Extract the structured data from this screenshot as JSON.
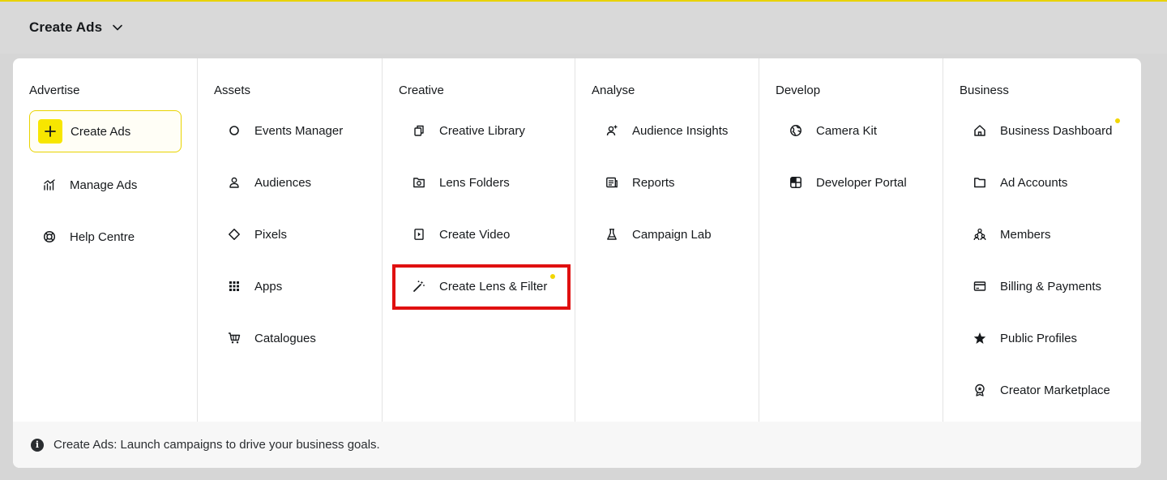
{
  "header": {
    "title": "Create Ads"
  },
  "columns": [
    {
      "heading": "Advertise",
      "items": [
        {
          "label": "Create Ads",
          "icon": "plus-icon"
        },
        {
          "label": "Manage Ads",
          "icon": "chart-icon"
        },
        {
          "label": "Help Centre",
          "icon": "lifebuoy-icon"
        }
      ]
    },
    {
      "heading": "Assets",
      "items": [
        {
          "label": "Events Manager",
          "icon": "circle-icon"
        },
        {
          "label": "Audiences",
          "icon": "person-icon"
        },
        {
          "label": "Pixels",
          "icon": "diamond-icon"
        },
        {
          "label": "Apps",
          "icon": "grid-icon"
        },
        {
          "label": "Catalogues",
          "icon": "cart-icon"
        }
      ]
    },
    {
      "heading": "Creative",
      "items": [
        {
          "label": "Creative Library",
          "icon": "copy-icon"
        },
        {
          "label": "Lens Folders",
          "icon": "camera-folder-icon"
        },
        {
          "label": "Create Video",
          "icon": "video-icon"
        },
        {
          "label": "Create Lens & Filter",
          "icon": "magic-wand-icon"
        }
      ]
    },
    {
      "heading": "Analyse",
      "items": [
        {
          "label": "Audience Insights",
          "icon": "audience-insights-icon"
        },
        {
          "label": "Reports",
          "icon": "report-icon"
        },
        {
          "label": "Campaign Lab",
          "icon": "flask-icon"
        }
      ]
    },
    {
      "heading": "Develop",
      "items": [
        {
          "label": "Camera Kit",
          "icon": "globe-icon"
        },
        {
          "label": "Developer Portal",
          "icon": "dev-portal-icon"
        }
      ]
    },
    {
      "heading": "Business",
      "items": [
        {
          "label": "Business Dashboard",
          "icon": "home-icon"
        },
        {
          "label": "Ad Accounts",
          "icon": "folder-icon"
        },
        {
          "label": "Members",
          "icon": "members-icon"
        },
        {
          "label": "Billing & Payments",
          "icon": "card-icon"
        },
        {
          "label": "Public Profiles",
          "icon": "star-icon"
        },
        {
          "label": "Creator Marketplace",
          "icon": "badge-icon"
        }
      ]
    }
  ],
  "footer": {
    "text": "Create Ads: Launch campaigns to drive your business goals."
  },
  "colors": {
    "accent": "#F7E600",
    "highlight": "#E01010",
    "dot": "#F2D600"
  }
}
